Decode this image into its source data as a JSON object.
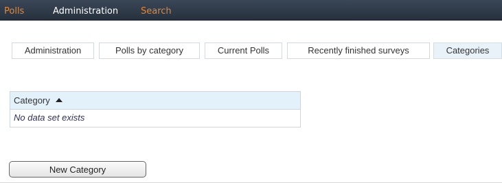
{
  "topnav": {
    "items": [
      {
        "label": "Polls"
      },
      {
        "label": "Administration"
      },
      {
        "label": "Search"
      }
    ]
  },
  "tabs": [
    {
      "label": "Administration",
      "active": false
    },
    {
      "label": "Polls by category",
      "active": false
    },
    {
      "label": "Current Polls",
      "active": false
    },
    {
      "label": "Recently finished surveys",
      "active": false
    },
    {
      "label": "Categories",
      "active": true
    }
  ],
  "grid": {
    "column_header": "Category",
    "sort_direction": "ascending",
    "sort_icon": "triangle-up-icon",
    "empty_message": "No data set exists"
  },
  "actions": {
    "new_category_label": "New Category"
  },
  "colors": {
    "nav_background": "#2e3947",
    "nav_accent": "#e8862e",
    "tab_active_background": "#e8f2f8",
    "grid_header_background": "#e3f1fb"
  }
}
